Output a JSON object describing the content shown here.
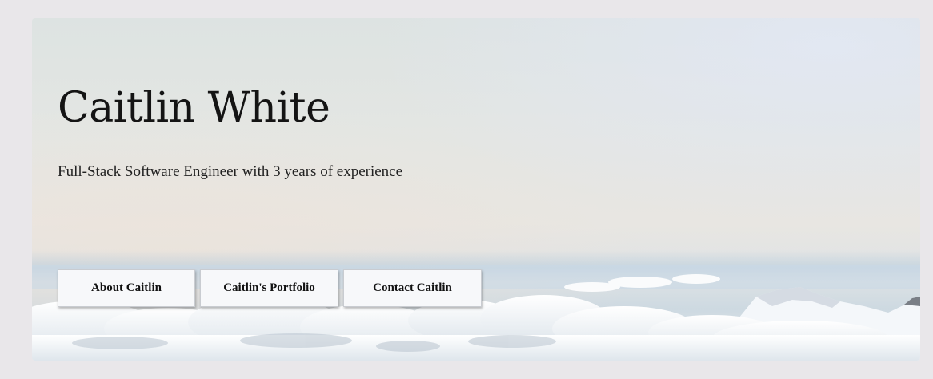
{
  "hero": {
    "title": "Caitlin White",
    "subtitle": "Full-Stack Software Engineer with 3 years of experience",
    "background": "sky-with-clouds-and-snowy-mountain"
  },
  "buttons": {
    "about_label": "About Caitlin",
    "portfolio_label": "Caitlin's Portfolio",
    "contact_label": "Contact Caitlin"
  },
  "colors": {
    "page_background": "#e9e7ea",
    "button_background": "#f7f8fa",
    "text": "#141414"
  }
}
